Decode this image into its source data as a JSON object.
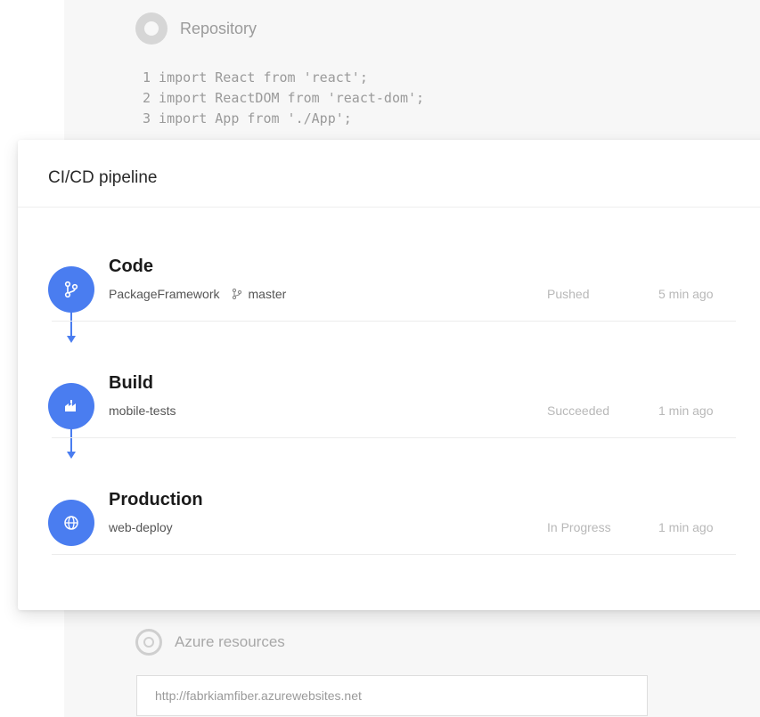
{
  "repository": {
    "title": "Repository",
    "code_lines": [
      "1 import React from 'react';",
      "2 import ReactDOM from 'react-dom';",
      "3 import App from './App';"
    ]
  },
  "pipeline": {
    "title": "CI/CD pipeline",
    "accent_color": "#4a7df0",
    "stages": [
      {
        "name": "Code",
        "icon": "git-branch-icon",
        "detail": "PackageFramework",
        "branch_icon": "git-branch-icon",
        "branch": "master",
        "status": "Pushed",
        "time": "5 min ago"
      },
      {
        "name": "Build",
        "icon": "build-factory-icon",
        "detail": "mobile-tests",
        "status": "Succeeded",
        "time": "1 min ago"
      },
      {
        "name": "Production",
        "icon": "globe-icon",
        "detail": "web-deploy",
        "status": "In Progress",
        "time": "1 min ago"
      }
    ]
  },
  "azure": {
    "title": "Azure resources",
    "url_value": "http://fabrkiamfiber.azurewebsites.net"
  }
}
